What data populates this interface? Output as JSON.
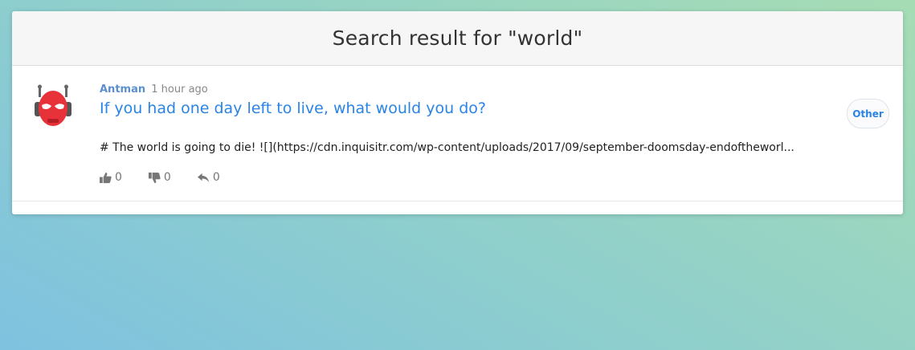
{
  "header": {
    "title": "Search result for \"world\""
  },
  "post": {
    "author": "Antman",
    "time": "1 hour ago",
    "title": "If you had one day left to live, what would you do?",
    "excerpt": "# The world is going to die! ![](https://cdn.inquisitr.com/wp-content/uploads/2017/09/september-doomsday-endoftheworl...",
    "category": "Other",
    "avatar_icon": "antman-helmet-icon",
    "actions": {
      "upvotes": "0",
      "downvotes": "0",
      "replies": "0"
    }
  },
  "colors": {
    "link": "#2a84e6",
    "author": "#5b8fd0",
    "avatar_red": "#e8323a"
  }
}
